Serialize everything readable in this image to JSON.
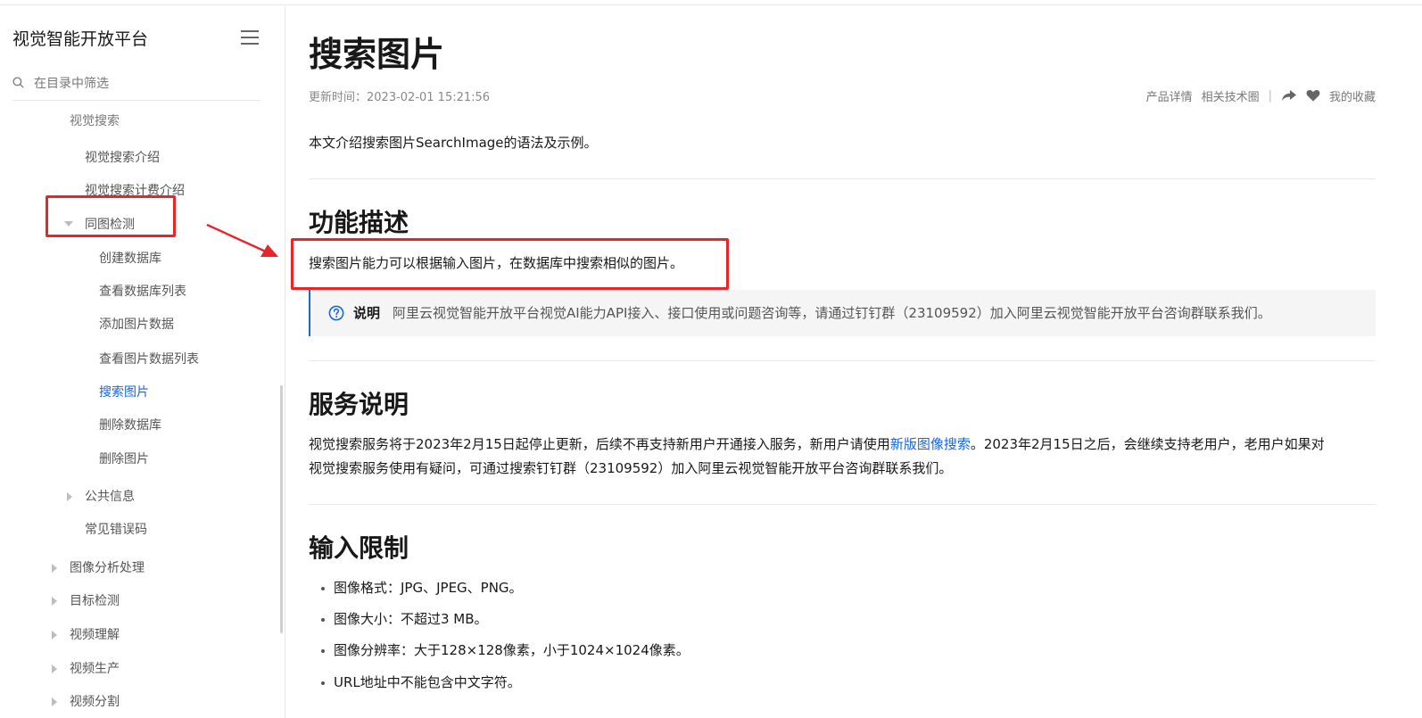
{
  "sidebar": {
    "title": "视觉智能开放平台",
    "search_placeholder": "在目录中筛选",
    "clipped_item": "视觉搜索",
    "items": [
      {
        "label": "视觉搜索介绍"
      },
      {
        "label": "视觉搜索计费介绍"
      },
      {
        "label": "同图检测"
      },
      {
        "label": "创建数据库"
      },
      {
        "label": "查看数据库列表"
      },
      {
        "label": "添加图片数据"
      },
      {
        "label": "查看图片数据列表"
      },
      {
        "label": "搜索图片"
      },
      {
        "label": "删除数据库"
      },
      {
        "label": "删除图片"
      },
      {
        "label": "公共信息"
      },
      {
        "label": "常见错误码"
      },
      {
        "label": "图像分析处理"
      },
      {
        "label": "目标检测"
      },
      {
        "label": "视频理解"
      },
      {
        "label": "视频生产"
      },
      {
        "label": "视频分割"
      }
    ]
  },
  "page": {
    "title": "搜索图片",
    "updated": "更新时间：2023-02-01 15:21:56",
    "actions": {
      "product_detail": "产品详情",
      "tech_circle": "相关技术圈",
      "separator": "|",
      "favorite": "我的收藏"
    },
    "intro": "本文介绍搜索图片SearchImage的语法及示例。",
    "sections": {
      "function": {
        "heading": "功能描述",
        "text": "搜索图片能力可以根据输入图片，在数据库中搜索相似的图片。",
        "note_label": "说明",
        "note_text": "阿里云视觉智能开放平台视觉AI能力API接入、接口使用或问题咨询等，请通过钉钉群（23109592）加入阿里云视觉智能开放平台咨询群联系我们。"
      },
      "service": {
        "heading": "服务说明",
        "line1_before": "视觉搜索服务将于2023年2月15日起停止更新，后续不再支持新用户开通接入服务，新用户请使用",
        "line1_link": "新版图像搜索",
        "line1_after": "。2023年2月15日之后，会继续支持老用户，老用户如果对",
        "line2": "视觉搜索服务使用有疑问，可通过搜索钉钉群（23109592）加入阿里云视觉智能开放平台咨询群联系我们。"
      },
      "input": {
        "heading": "输入限制",
        "bullets": [
          "图像格式：JPG、JPEG、PNG。",
          "图像大小：不超过3 MB。",
          "图像分辨率：大于128×128像素，小于1024×1024像素。",
          "URL地址中不能包含中文字符。"
        ]
      }
    }
  },
  "colors": {
    "accent": "#1a66e0",
    "annotation": "#e8262a"
  }
}
